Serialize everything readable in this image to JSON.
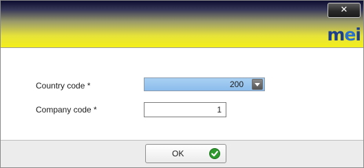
{
  "window": {
    "close_label": "✕",
    "logo": {
      "part1": "m",
      "part2": "e",
      "part3": "i"
    }
  },
  "form": {
    "country": {
      "label": "Country code *",
      "value": "200"
    },
    "company": {
      "label": "Company code *",
      "value": "1"
    }
  },
  "footer": {
    "ok_label": "OK"
  },
  "colors": {
    "combo_fill": "#8cbcec",
    "header_yellow": "#f4ef1a",
    "ok_check": "#2e9a2e"
  }
}
